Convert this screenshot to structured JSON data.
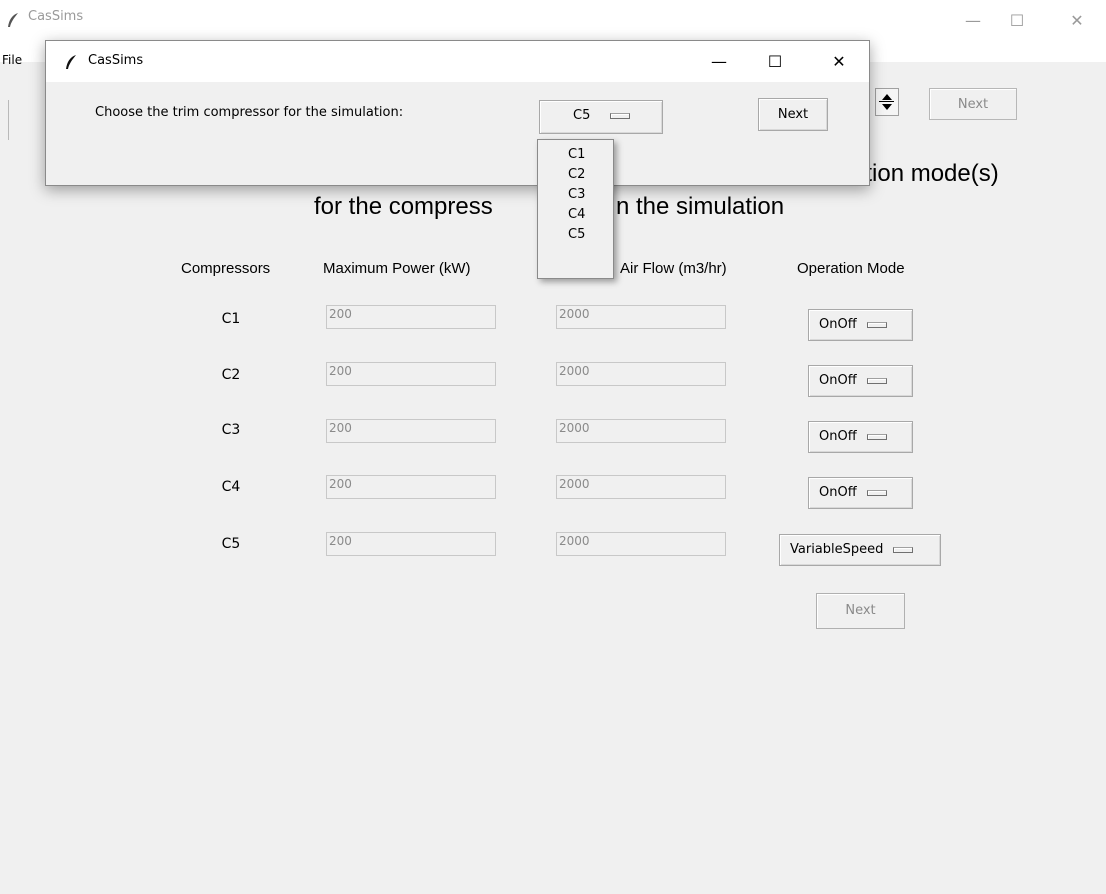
{
  "main_window": {
    "title": "CasSims",
    "menu": {
      "file": "File"
    },
    "controls": {
      "minimize": "—",
      "maximize": "☐",
      "close": "✕"
    }
  },
  "main": {
    "top_next_label": "Next",
    "heading_line1_visible": "ation mode(s)",
    "heading_line2_left": "for the compress",
    "heading_line2_right": "n the simulation",
    "columns": {
      "compressors": "Compressors",
      "max_power": "Maximum Power (kW)",
      "air_flow_visible": "Air Flow (m3/hr)",
      "operation_mode": "Operation Mode"
    },
    "rows": [
      {
        "label": "C1",
        "power": "200",
        "flow": "2000",
        "mode": "OnOff"
      },
      {
        "label": "C2",
        "power": "200",
        "flow": "2000",
        "mode": "OnOff"
      },
      {
        "label": "C3",
        "power": "200",
        "flow": "2000",
        "mode": "OnOff"
      },
      {
        "label": "C4",
        "power": "200",
        "flow": "2000",
        "mode": "OnOff"
      },
      {
        "label": "C5",
        "power": "200",
        "flow": "2000",
        "mode": "VariableSpeed"
      }
    ],
    "bottom_next_label": "Next"
  },
  "dialog": {
    "title": "CasSims",
    "controls": {
      "minimize": "—",
      "maximize": "☐",
      "close": "✕"
    },
    "prompt": "Choose the trim compressor for the simulation:",
    "selected": "C5",
    "next_label": "Next",
    "options": [
      "C1",
      "C2",
      "C3",
      "C4",
      "C5"
    ]
  },
  "icons": {
    "app": "feather-icon",
    "spinbox": "spinbox-arrows-icon",
    "option_indicator": "option-menu-indicator-icon"
  }
}
